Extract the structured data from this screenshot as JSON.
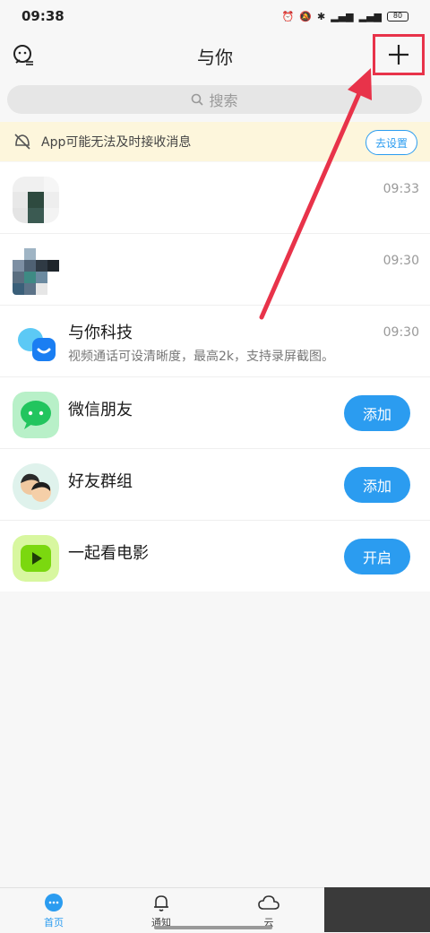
{
  "status_bar": {
    "time": "09:38",
    "battery": "80"
  },
  "header": {
    "title": "与你"
  },
  "search": {
    "placeholder": "搜索"
  },
  "notice": {
    "text": "App可能无法及时接收消息",
    "action": "去设置"
  },
  "conversations": [
    {
      "name": "",
      "time": "09:33"
    },
    {
      "name": "",
      "time": "09:30"
    },
    {
      "name": "与你科技",
      "subtitle": "视频通话可设清晰度，最高2k，支持录屏截图。",
      "time": "09:30"
    },
    {
      "name": "微信朋友",
      "action": "添加"
    },
    {
      "name": "好友群组",
      "action": "添加"
    },
    {
      "name": "一起看电影",
      "action": "开启"
    }
  ],
  "tabs": [
    {
      "label": "首页",
      "icon": "chat-bubble-icon"
    },
    {
      "label": "通知",
      "icon": "bell-icon"
    },
    {
      "label": "云",
      "icon": "cloud-icon"
    }
  ],
  "colors": {
    "accent": "#2b9cf0",
    "annotation": "#e8334a",
    "notice_bg": "#fdf6dc"
  }
}
